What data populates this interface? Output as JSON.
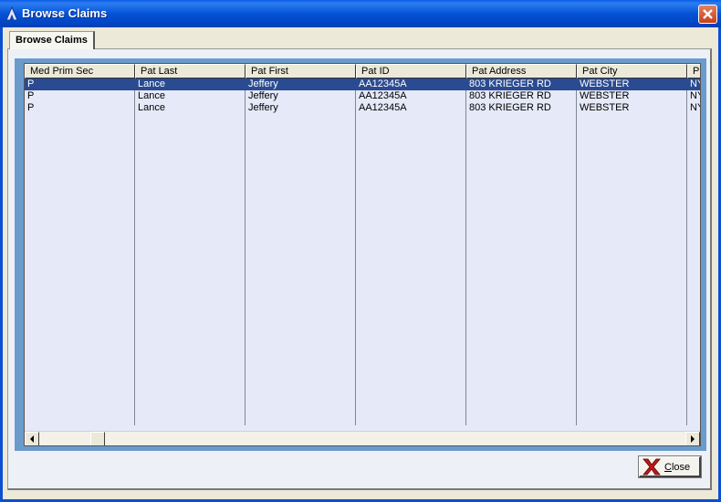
{
  "window": {
    "title": "Browse Claims"
  },
  "tab": {
    "label": "Browse Claims"
  },
  "grid": {
    "columns": [
      "Med Prim Sec",
      "Pat Last",
      "Pat First",
      "Pat ID",
      "Pat Address",
      "Pat City",
      "P"
    ],
    "rows": [
      [
        "P",
        "Lance",
        "Jeffery",
        "AA12345A",
        "803 KRIEGER RD",
        "WEBSTER",
        "NY"
      ],
      [
        "P",
        "Lance",
        "Jeffery",
        "AA12345A",
        "803 KRIEGER RD",
        "WEBSTER",
        "NY"
      ],
      [
        "P",
        "Lance",
        "Jeffery",
        "AA12345A",
        "803 KRIEGER RD",
        "WEBSTER",
        "NY"
      ]
    ],
    "selected_row": 0
  },
  "close_button": {
    "label_first": "C",
    "label_rest": "lose"
  },
  "colors": {
    "title_bar": "#0553d8",
    "selection": "#2a4b91",
    "grid_frame": "#6a9bcb"
  },
  "icons": {
    "title": "app-icon",
    "window_close": "close-icon",
    "button": "red-x-icon"
  }
}
